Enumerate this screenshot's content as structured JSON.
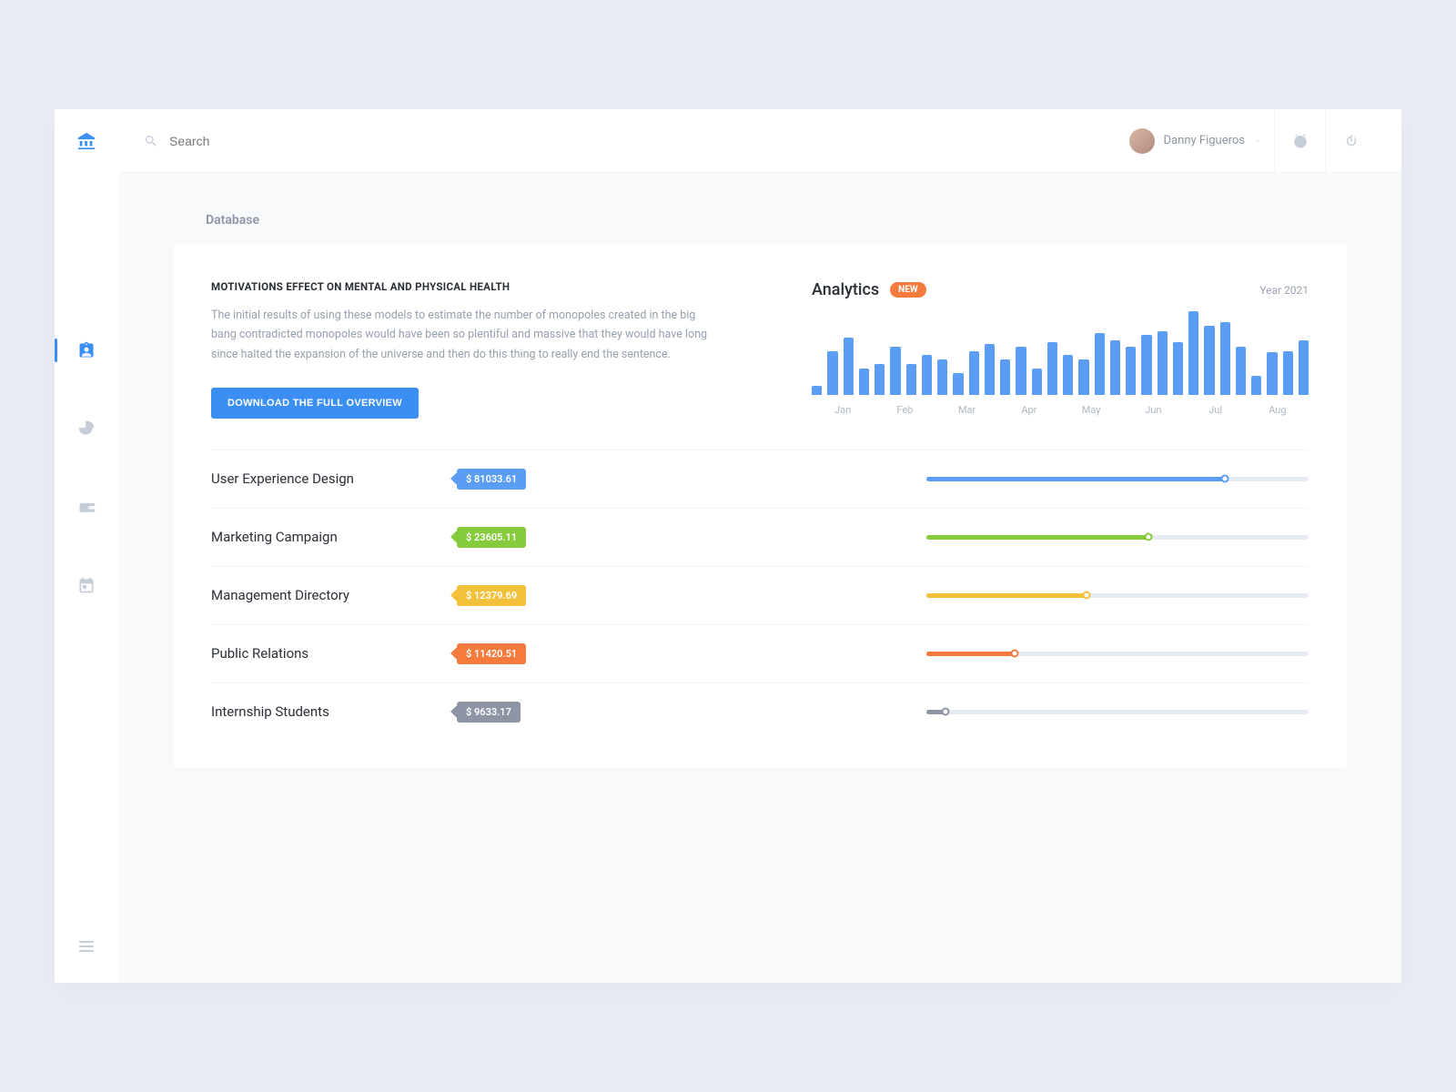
{
  "page_title": "Database",
  "search_placeholder": "Search",
  "user": {
    "name": "Danny Figueros"
  },
  "overview": {
    "title": "MOTIVATIONS EFFECT ON MENTAL AND PHYSICAL HEALTH",
    "body": "The initial results of using these models to estimate the number of monopoles created in the big bang contradicted monopoles would have been so plentiful and massive that they would have long since halted the expansion of the universe and then do this thing to really end the sentence.",
    "button": "DOWNLOAD THE FULL OVERVIEW"
  },
  "analytics": {
    "title": "Analytics",
    "badge": "NEW",
    "year": "Year 2021"
  },
  "chart_data": {
    "type": "bar",
    "categories": [
      "Jan",
      "Feb",
      "Mar",
      "Apr",
      "May",
      "Jun",
      "Jul",
      "Aug"
    ],
    "groups_per_category": 4,
    "values_pct": [
      10,
      50,
      65,
      30,
      35,
      55,
      35,
      45,
      40,
      25,
      50,
      58,
      40,
      55,
      30,
      60,
      45,
      40,
      70,
      62,
      55,
      68,
      72,
      60,
      95,
      78,
      82,
      55,
      22,
      48,
      50,
      62
    ],
    "note": "values are bar heights as approximate percent of max; no y-axis shown in source image"
  },
  "rows": [
    {
      "label": "User Experience Design",
      "amount": "$ 81033.61",
      "color": "#5b9cf4",
      "progress": 78
    },
    {
      "label": "Marketing Campaign",
      "amount": "$ 23605.11",
      "color": "#86cb3c",
      "progress": 58
    },
    {
      "label": "Management Directory",
      "amount": "$ 12379.69",
      "color": "#f3c03a",
      "progress": 42
    },
    {
      "label": "Public Relations",
      "amount": "$ 11420.51",
      "color": "#f47b3d",
      "progress": 23
    },
    {
      "label": "Internship Students",
      "amount": "$ 9633.17",
      "color": "#8d95a5",
      "progress": 5
    }
  ]
}
